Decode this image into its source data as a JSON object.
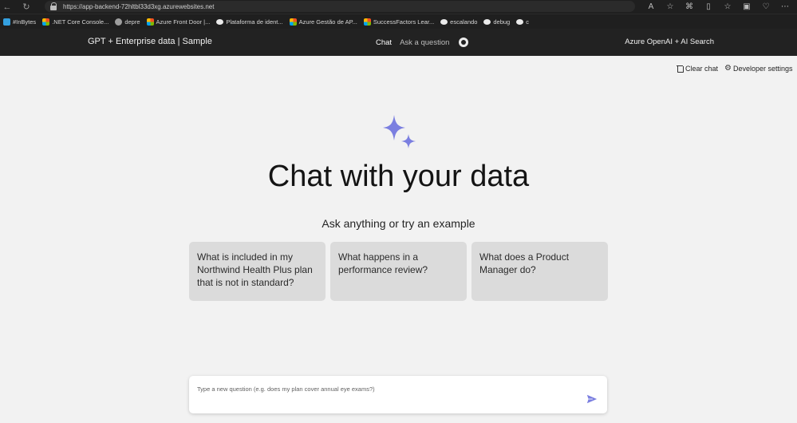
{
  "browser": {
    "url_host": "https://app-backend-72hltbl33d3xg.azurewebsites.net",
    "url_path": "",
    "bookmarks": [
      {
        "label": "#InBytes",
        "icon": "fig"
      },
      {
        "label": ".NET Core Console...",
        "icon": "ms"
      },
      {
        "label": "depre",
        "icon": "grey"
      },
      {
        "label": "Azure Front Door |...",
        "icon": "ms"
      },
      {
        "label": "Plataforma de ident...",
        "icon": "dark"
      },
      {
        "label": "Azure Gestão de AP...",
        "icon": "ms"
      },
      {
        "label": "SuccessFactors Lear...",
        "icon": "ms"
      },
      {
        "label": "escalando",
        "icon": "dark"
      },
      {
        "label": "debug",
        "icon": "dark"
      },
      {
        "label": "c",
        "icon": "dark"
      }
    ]
  },
  "header": {
    "title": "GPT + Enterprise data | Sample",
    "nav_chat": "Chat",
    "nav_ask": "Ask a question",
    "right_label": "Azure OpenAI + AI Search"
  },
  "commands": {
    "clear_chat": "Clear chat",
    "developer_settings": "Developer settings"
  },
  "hero": {
    "title": "Chat with your data",
    "subtitle": "Ask anything or try an example",
    "accent_color": "#7b7fe0"
  },
  "examples": [
    "What is included in my Northwind Health Plus plan that is not in standard?",
    "What happens in a performance review?",
    "What does a Product Manager do?"
  ],
  "question": {
    "placeholder": "Type a new question (e.g. does my plan cover annual eye exams?)",
    "value": ""
  }
}
